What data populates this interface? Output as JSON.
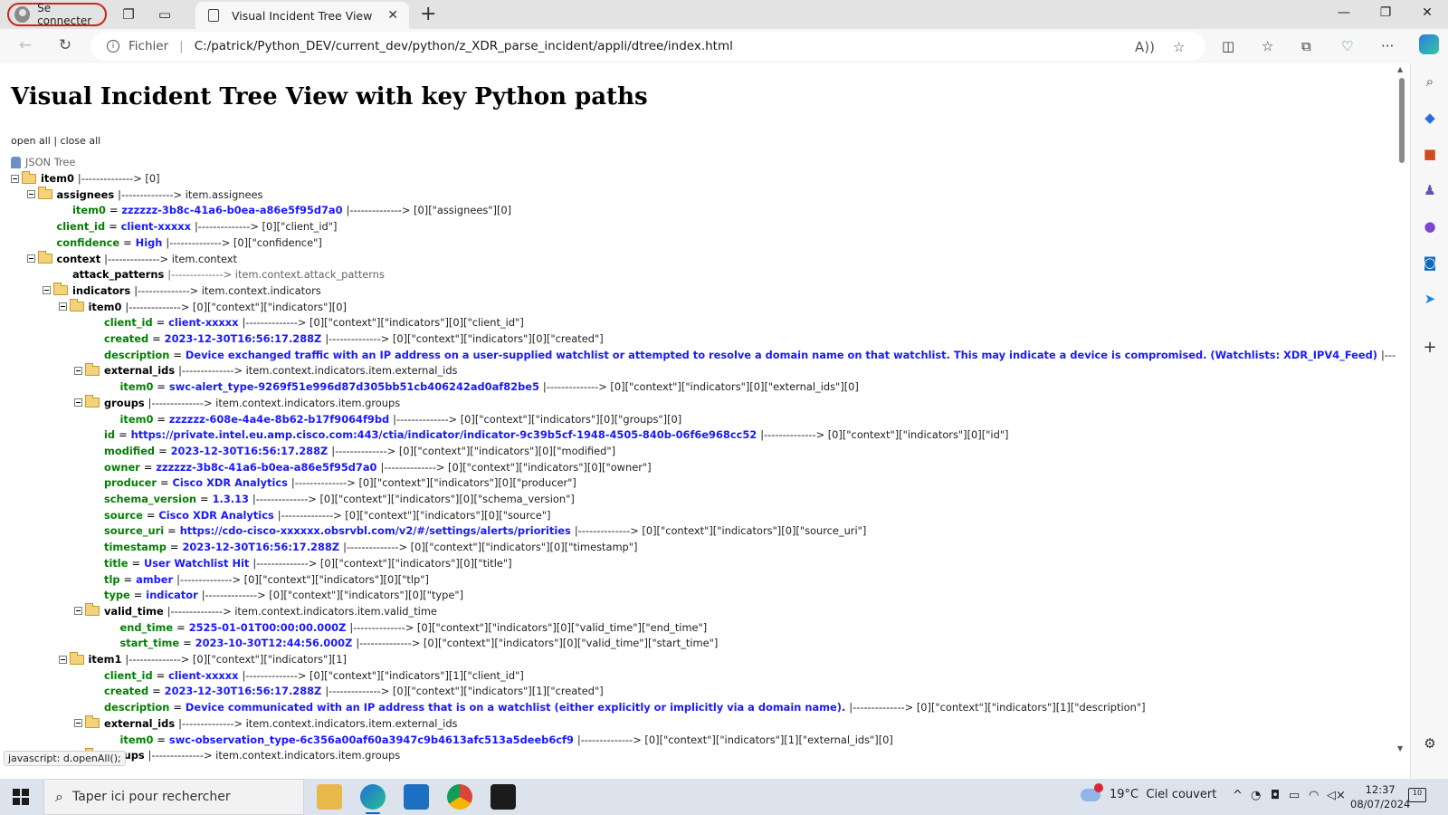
{
  "browser": {
    "profile_label": "Se connecter",
    "tab_title": "Visual Incident Tree View",
    "url_scheme_label": "Fichier",
    "url": "C:/patrick/Python_DEV/current_dev/python/z_XDR_parse_incident/appli/dtree/index.html",
    "status_tooltip": "javascript: d.openAll();"
  },
  "page": {
    "heading": "Visual Incident Tree View with key Python paths",
    "open_all": "open all",
    "separator": "|",
    "close_all": "close all",
    "root_label": "JSON Tree"
  },
  "tree": [
    {
      "level": 0,
      "type": "folder",
      "key": "item0",
      "path": "|--------------> [0]"
    },
    {
      "level": 1,
      "type": "folder",
      "key": "assignees",
      "path": "|--------------> item.assignees"
    },
    {
      "level": 2,
      "type": "leaf",
      "key": "item0",
      "value": "zzzzzz-3b8c-41a6-b0ea-a86e5f95d7a0",
      "path": "|--------------> [0][\"assignees\"][0]"
    },
    {
      "level": 1,
      "type": "leaf",
      "key": "client_id",
      "value": "client-xxxxx",
      "path": "|--------------> [0][\"client_id\"]"
    },
    {
      "level": 1,
      "type": "leaf",
      "key": "confidence",
      "value": "High",
      "path": "|--------------> [0][\"confidence\"]"
    },
    {
      "level": 1,
      "type": "folder",
      "key": "context",
      "path": "|--------------> item.context"
    },
    {
      "level": 2,
      "type": "empty",
      "key": "attack_patterns",
      "path": "|--------------> item.context.attack_patterns"
    },
    {
      "level": 2,
      "type": "folder",
      "key": "indicators",
      "path": "|--------------> item.context.indicators"
    },
    {
      "level": 3,
      "type": "folder",
      "key": "item0",
      "path": "|--------------> [0][\"context\"][\"indicators\"][0]"
    },
    {
      "level": 4,
      "type": "leaf",
      "key": "client_id",
      "value": "client-xxxxx",
      "path": "|--------------> [0][\"context\"][\"indicators\"][0][\"client_id\"]"
    },
    {
      "level": 4,
      "type": "leaf",
      "key": "created",
      "value": "2023-12-30T16:56:17.288Z",
      "path": "|--------------> [0][\"context\"][\"indicators\"][0][\"created\"]"
    },
    {
      "level": 4,
      "type": "leaf",
      "key": "description",
      "value": "Device exchanged traffic with an IP address on a user-supplied watchlist or attempted to resolve a domain name on that watchlist. This may indicate a device is compromised. (Watchlists: XDR_IPV4_Feed)",
      "path": "|-------------"
    },
    {
      "level": 4,
      "type": "folder",
      "key": "external_ids",
      "path": "|--------------> item.context.indicators.item.external_ids"
    },
    {
      "level": 5,
      "type": "leaf",
      "key": "item0",
      "value": "swc-alert_type-9269f51e996d87d305bb51cb406242ad0af82be5",
      "path": "|--------------> [0][\"context\"][\"indicators\"][0][\"external_ids\"][0]"
    },
    {
      "level": 4,
      "type": "folder",
      "key": "groups",
      "path": "|--------------> item.context.indicators.item.groups"
    },
    {
      "level": 5,
      "type": "leaf",
      "key": "item0",
      "value": "zzzzzz-608e-4a4e-8b62-b17f9064f9bd",
      "path": "|--------------> [0][\"context\"][\"indicators\"][0][\"groups\"][0]"
    },
    {
      "level": 4,
      "type": "leaf",
      "key": "id",
      "value": "https://private.intel.eu.amp.cisco.com:443/ctia/indicator/indicator-9c39b5cf-1948-4505-840b-06f6e968cc52",
      "path": "|--------------> [0][\"context\"][\"indicators\"][0][\"id\"]"
    },
    {
      "level": 4,
      "type": "leaf",
      "key": "modified",
      "value": "2023-12-30T16:56:17.288Z",
      "path": "|--------------> [0][\"context\"][\"indicators\"][0][\"modified\"]"
    },
    {
      "level": 4,
      "type": "leaf",
      "key": "owner",
      "value": "zzzzzz-3b8c-41a6-b0ea-a86e5f95d7a0",
      "path": "|--------------> [0][\"context\"][\"indicators\"][0][\"owner\"]"
    },
    {
      "level": 4,
      "type": "leaf",
      "key": "producer",
      "value": "Cisco XDR Analytics",
      "path": "|--------------> [0][\"context\"][\"indicators\"][0][\"producer\"]"
    },
    {
      "level": 4,
      "type": "leaf",
      "key": "schema_version",
      "value": "1.3.13",
      "path": "|--------------> [0][\"context\"][\"indicators\"][0][\"schema_version\"]"
    },
    {
      "level": 4,
      "type": "leaf",
      "key": "source",
      "value": "Cisco XDR Analytics",
      "path": "|--------------> [0][\"context\"][\"indicators\"][0][\"source\"]"
    },
    {
      "level": 4,
      "type": "leaf",
      "key": "source_uri",
      "value": "https://cdo-cisco-xxxxxx.obsrvbl.com/v2/#/settings/alerts/priorities",
      "path": "|--------------> [0][\"context\"][\"indicators\"][0][\"source_uri\"]"
    },
    {
      "level": 4,
      "type": "leaf",
      "key": "timestamp",
      "value": "2023-12-30T16:56:17.288Z",
      "path": "|--------------> [0][\"context\"][\"indicators\"][0][\"timestamp\"]"
    },
    {
      "level": 4,
      "type": "leaf",
      "key": "title",
      "value": "User Watchlist Hit",
      "path": "|--------------> [0][\"context\"][\"indicators\"][0][\"title\"]"
    },
    {
      "level": 4,
      "type": "leaf",
      "key": "tlp",
      "value": "amber",
      "path": "|--------------> [0][\"context\"][\"indicators\"][0][\"tlp\"]"
    },
    {
      "level": 4,
      "type": "leaf",
      "key": "type",
      "value": "indicator",
      "path": "|--------------> [0][\"context\"][\"indicators\"][0][\"type\"]"
    },
    {
      "level": 4,
      "type": "folder",
      "key": "valid_time",
      "path": "|--------------> item.context.indicators.item.valid_time"
    },
    {
      "level": 5,
      "type": "leaf",
      "key": "end_time",
      "value": "2525-01-01T00:00:00.000Z",
      "path": "|--------------> [0][\"context\"][\"indicators\"][0][\"valid_time\"][\"end_time\"]"
    },
    {
      "level": 5,
      "type": "leaf",
      "key": "start_time",
      "value": "2023-10-30T12:44:56.000Z",
      "path": "|--------------> [0][\"context\"][\"indicators\"][0][\"valid_time\"][\"start_time\"]"
    },
    {
      "level": 3,
      "type": "folder",
      "key": "item1",
      "path": "|--------------> [0][\"context\"][\"indicators\"][1]"
    },
    {
      "level": 4,
      "type": "leaf",
      "key": "client_id",
      "value": "client-xxxxx",
      "path": "|--------------> [0][\"context\"][\"indicators\"][1][\"client_id\"]"
    },
    {
      "level": 4,
      "type": "leaf",
      "key": "created",
      "value": "2023-12-30T16:56:17.288Z",
      "path": "|--------------> [0][\"context\"][\"indicators\"][1][\"created\"]"
    },
    {
      "level": 4,
      "type": "leaf",
      "key": "description",
      "value": "Device communicated with an IP address that is on a watchlist (either explicitly or implicitly via a domain name).",
      "path": "|--------------> [0][\"context\"][\"indicators\"][1][\"description\"]"
    },
    {
      "level": 4,
      "type": "folder",
      "key": "external_ids",
      "path": "|--------------> item.context.indicators.item.external_ids"
    },
    {
      "level": 5,
      "type": "leaf",
      "key": "item0",
      "value": "swc-observation_type-6c356a00af60a3947c9b4613afc513a5deeb6cf9",
      "path": "|--------------> [0][\"context\"][\"indicators\"][1][\"external_ids\"][0]"
    },
    {
      "level": 4,
      "type": "folder",
      "key": "groups",
      "path": "|--------------> item.context.indicators.item.groups"
    }
  ],
  "taskbar": {
    "search_placeholder": "Taper ici pour rechercher",
    "temperature": "19°C",
    "weather": "Ciel couvert",
    "time": "12:37",
    "date": "08/07/2024",
    "notification_count": "10"
  },
  "colors": {
    "key_green": "#008000",
    "value_blue": "#1a1aff",
    "accent": "#0067c0"
  }
}
